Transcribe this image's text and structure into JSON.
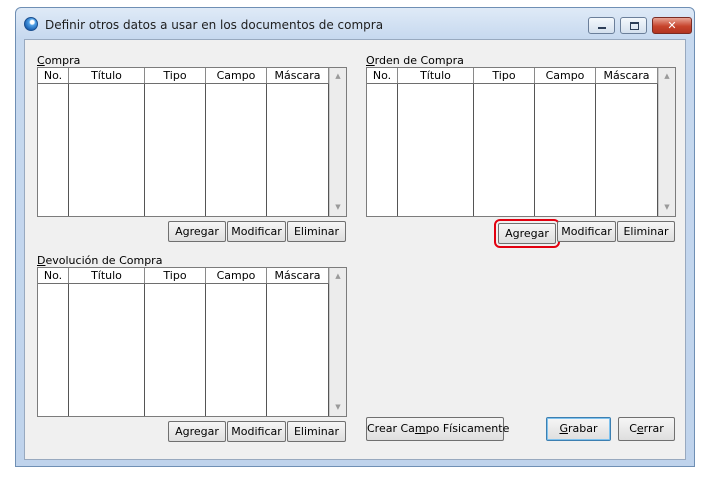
{
  "window": {
    "title": "Definir otros datos a usar en los documentos de compra",
    "close_symbol": "✕"
  },
  "columns": [
    "No.",
    "Título",
    "Tipo",
    "Campo",
    "Máscara"
  ],
  "sections": {
    "compra": {
      "label": "Compra",
      "label_mnemonic": "C",
      "label_rest": "ompra"
    },
    "orden": {
      "label": "Orden de Compra",
      "label_mnemonic": "O",
      "label_rest": "rden de Compra"
    },
    "devolucion": {
      "label": "Devolución de Compra",
      "label_mnemonic": "D",
      "label_rest": "evolución de Compra"
    }
  },
  "buttons": {
    "agregar": "Agregar",
    "modificar": "Modificar",
    "eliminar": "Eliminar",
    "crear_campo": {
      "label": "Crear Campo Físicamente",
      "pre": "Crear Ca",
      "mnemonic": "m",
      "post": "po Físicamente"
    },
    "grabar": {
      "label": "Grabar",
      "mnemonic": "G",
      "post": "rabar"
    },
    "cerrar": {
      "label": "Cerrar",
      "pre": "C",
      "mnemonic": "e",
      "post": "rrar"
    }
  },
  "icons": {
    "app": "app-globe-icon",
    "minimize": "minimize-icon",
    "maximize": "maximize-icon",
    "close": "close-icon",
    "scroll_up": "scroll-up-arrow-icon",
    "scroll_down": "scroll-down-arrow-icon"
  },
  "colors": {
    "highlight": "#e3000f",
    "title_gradient_top": "#dfeaf7",
    "client_bg": "#f0f0f0"
  }
}
